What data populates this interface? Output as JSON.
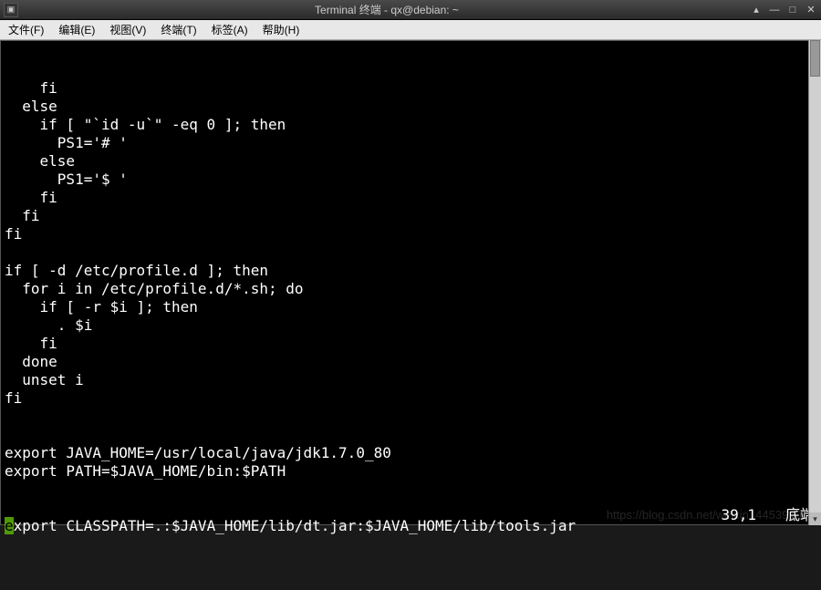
{
  "window": {
    "title": "Terminal 终端 - qx@debian: ~"
  },
  "menu": {
    "file": "文件(F)",
    "edit": "编辑(E)",
    "view": "视图(V)",
    "terminal": "终端(T)",
    "tabs": "标签(A)",
    "help": "帮助(H)"
  },
  "lines": [
    "    fi",
    "  else",
    "    if [ \"`id -u`\" -eq 0 ]; then",
    "      PS1='# '",
    "    else",
    "      PS1='$ '",
    "    fi",
    "  fi",
    "fi",
    "",
    "if [ -d /etc/profile.d ]; then",
    "  for i in /etc/profile.d/*.sh; do",
    "    if [ -r $i ]; then",
    "      . $i",
    "    fi",
    "  done",
    "  unset i",
    "fi",
    "",
    "",
    "export JAVA_HOME=/usr/local/java/jdk1.7.0_80",
    "export PATH=$JAVA_HOME/bin:$PATH"
  ],
  "cursor_line": {
    "cursor_char": "e",
    "rest": "xport CLASSPATH=.:$JAVA_HOME/lib/dt.jar:$JAVA_HOME/lib/tools.jar"
  },
  "status": {
    "position": "39,1",
    "mode": "底端"
  },
  "watermark": "https://blog.csdn.net/weixin_44539107"
}
